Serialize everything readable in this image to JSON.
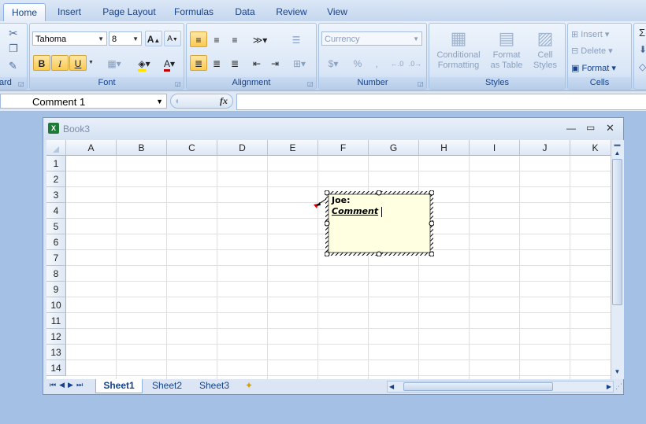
{
  "tabs": [
    "Home",
    "Insert",
    "Page Layout",
    "Formulas",
    "Data",
    "Review",
    "View"
  ],
  "active_tab": "Home",
  "clipboard": {
    "label": "ard"
  },
  "font": {
    "label": "Font",
    "name": "Tahoma",
    "size": "8",
    "bold": "B",
    "italic": "I",
    "underline": "U"
  },
  "alignment": {
    "label": "Alignment"
  },
  "number": {
    "label": "Number",
    "format": "Currency",
    "currency_symbol": "$",
    "percent": "%",
    "comma": ","
  },
  "styles": {
    "label": "Styles",
    "conditional": "Conditional",
    "formatting": "Formatting",
    "format_as": "Format",
    "as_table": "as Table",
    "cell": "Cell",
    "cell_styles": "Styles"
  },
  "cells": {
    "label": "Cells",
    "insert": "Insert",
    "delete": "Delete",
    "format": "Format"
  },
  "formula_bar": {
    "name_box": "Comment 1",
    "fx": "fx"
  },
  "workbook": {
    "title": "Book3"
  },
  "columns": [
    "A",
    "B",
    "C",
    "D",
    "E",
    "F",
    "G",
    "H",
    "I",
    "J",
    "K"
  ],
  "rows": [
    "1",
    "2",
    "3",
    "4",
    "5",
    "6",
    "7",
    "8",
    "9",
    "10",
    "11",
    "12",
    "13",
    "14"
  ],
  "sheets": [
    "Sheet1",
    "Sheet2",
    "Sheet3"
  ],
  "active_sheet": "Sheet1",
  "comment": {
    "author": "Joe:",
    "text": "Comment"
  },
  "colors": {
    "accent": "#15428b",
    "ribbon": "#d6e3f4",
    "active_button": "#fbc94f",
    "comment_bg": "#ffffe1"
  }
}
